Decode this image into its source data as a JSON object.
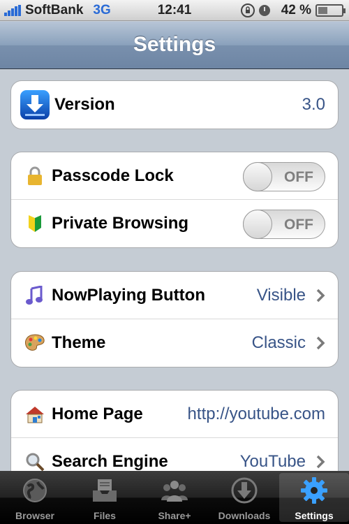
{
  "status_bar": {
    "carrier": "SoftBank",
    "network": "3G",
    "time": "12:41",
    "battery": "42 %",
    "battery_level": 0.42
  },
  "nav": {
    "title": "Settings"
  },
  "groups": {
    "version": {
      "label": "Version",
      "value": "3.0",
      "icon": "app-download-icon"
    },
    "passcode": {
      "label": "Passcode Lock",
      "state": "OFF",
      "icon": "lock-icon"
    },
    "private": {
      "label": "Private Browsing",
      "state": "OFF",
      "icon": "beginner-mark-icon"
    },
    "nowplaying": {
      "label": "NowPlaying Button",
      "value": "Visible",
      "icon": "music-note-icon"
    },
    "theme": {
      "label": "Theme",
      "value": "Classic",
      "icon": "palette-icon"
    },
    "homepage": {
      "label": "Home Page",
      "value": "http://youtube.com",
      "icon": "house-icon"
    },
    "search": {
      "label": "Search Engine",
      "value": "YouTube",
      "icon": "magnifier-icon"
    }
  },
  "tabs": [
    {
      "label": "Browser",
      "icon": "globe-icon",
      "active": false
    },
    {
      "label": "Files",
      "icon": "inbox-tray-icon",
      "active": false
    },
    {
      "label": "Share+",
      "icon": "people-icon",
      "active": false
    },
    {
      "label": "Downloads",
      "icon": "download-arrow-icon",
      "active": false
    },
    {
      "label": "Settings",
      "icon": "gear-icon",
      "active": true
    }
  ],
  "colors": {
    "accent_value": "#385487",
    "signal_blue": "#2a6bd6",
    "background": "#c5ccd4"
  }
}
